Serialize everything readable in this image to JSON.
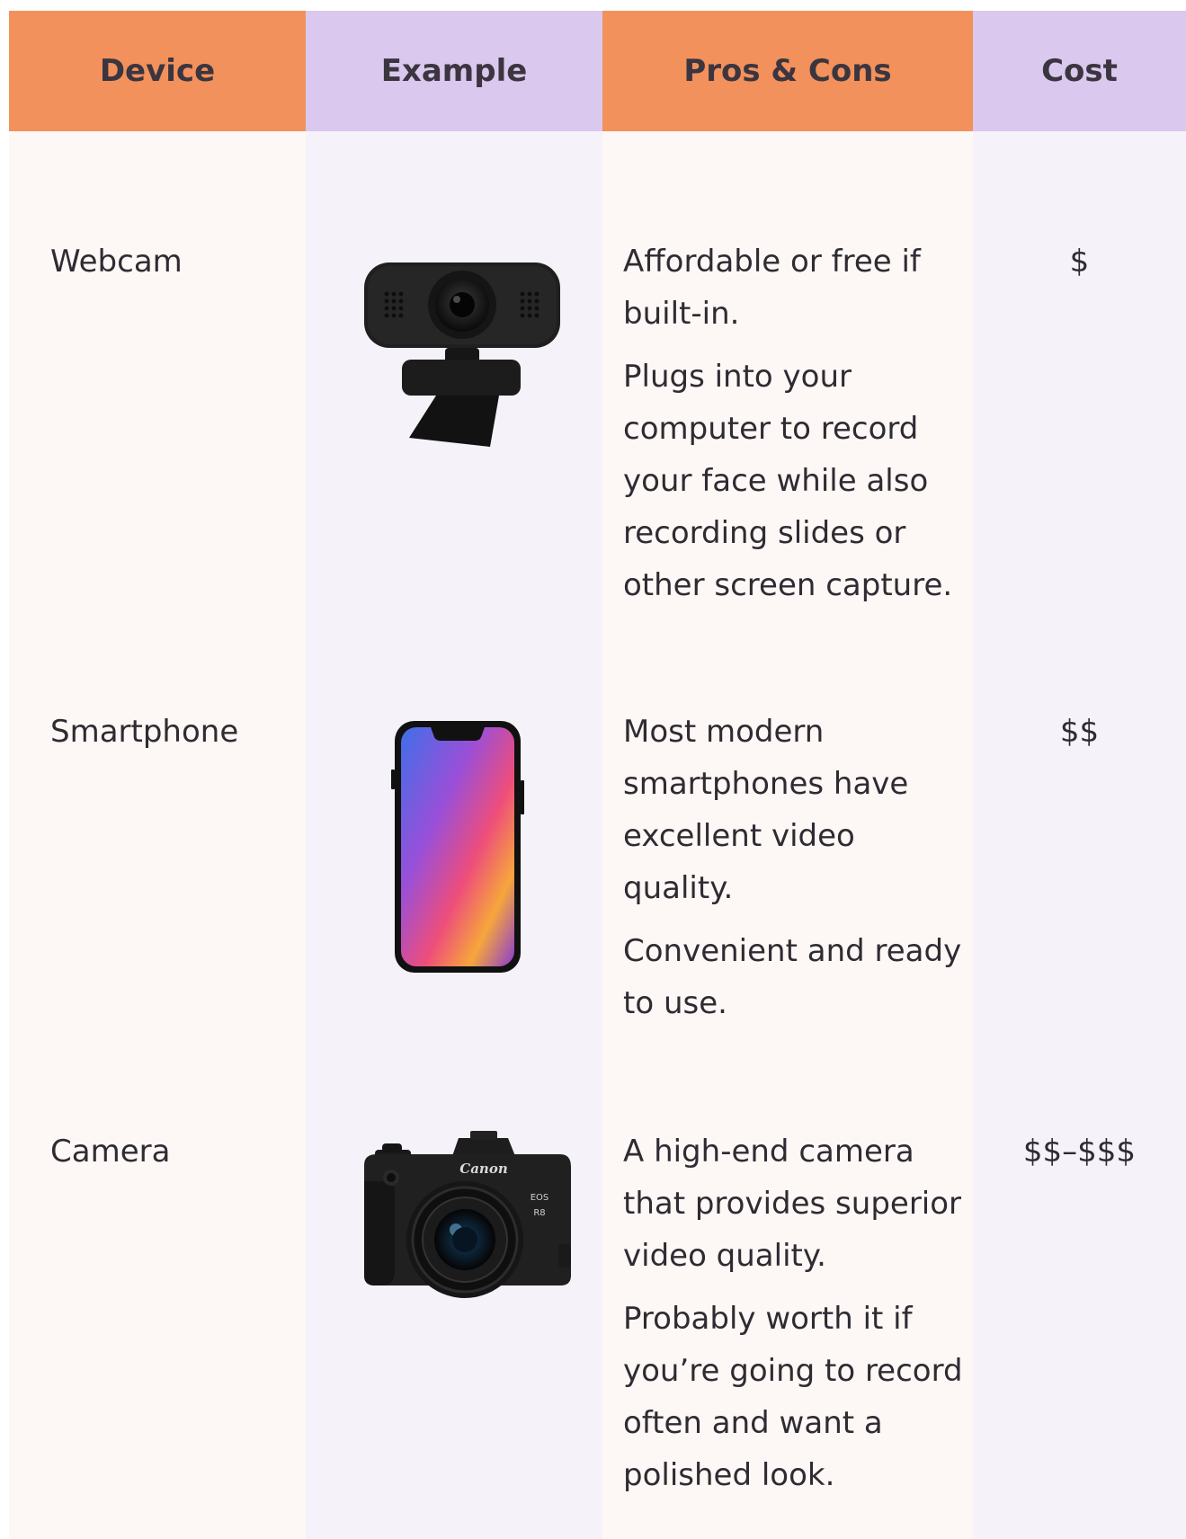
{
  "headers": {
    "device": "Device",
    "example": "Example",
    "pros_cons": "Pros & Cons",
    "cost": "Cost"
  },
  "rows": [
    {
      "device": "Webcam",
      "example_icon": "webcam-icon",
      "pros": [
        "Affordable or free if built-in.",
        "Plugs into your computer to record your face while also recording slides or other screen capture."
      ],
      "cost": "$"
    },
    {
      "device": "Smartphone",
      "example_icon": "smartphone-icon",
      "pros": [
        "Most modern smartphones have excellent video quality.",
        "Convenient and ready to use."
      ],
      "cost": "$$"
    },
    {
      "device": "Camera",
      "example_icon": "camera-icon",
      "camera_brand": "Canon",
      "camera_model_line1": "EOS",
      "camera_model_line2": "R8",
      "pros": [
        "A high-end camera that provides superior video quality.",
        "Probably worth it if you’re going to record often and want a polished look."
      ],
      "cost": "$$–$$$"
    }
  ],
  "colors": {
    "orange_header": "#f2915c",
    "lavender_header": "#dac8ee",
    "cream_column": "#fdf8f5",
    "lavender_column": "#f5f2fa"
  }
}
